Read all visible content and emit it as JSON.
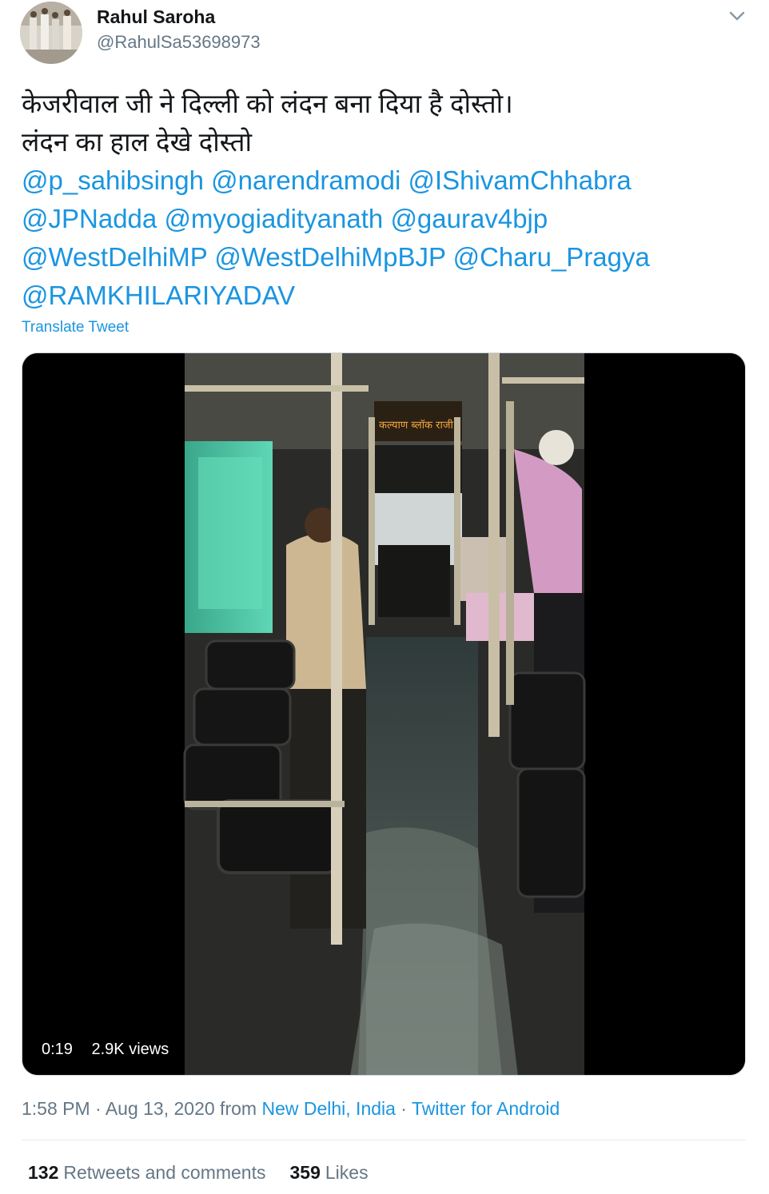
{
  "user": {
    "name": "Rahul Saroha",
    "handle": "@RahulSa53698973"
  },
  "tweet": {
    "lines": [
      [
        "केजरीवाल जी ने दिल्ली को लंदन बना दिया है दोस्तो।"
      ],
      [
        "लंदन का हाल देखे दोस्तो"
      ],
      [
        "@p_sahibsingh",
        "@narendramodi",
        "@IShivamChhabra"
      ],
      [
        "@JPNadda",
        "@myogiadityanath",
        "@gaurav4bjp"
      ],
      [
        "@WestDelhiMP",
        "@WestDelhiMpBJP",
        "@Charu_Pragya"
      ],
      [
        "@RAMKHILARIYADAV"
      ]
    ],
    "translate_label": "Translate Tweet"
  },
  "video": {
    "duration": "0:19",
    "views": "2.9K views",
    "bus_sign_text": "कल्याण ब्लॉक राजी"
  },
  "meta": {
    "time": "1:58 PM",
    "sep1": " · ",
    "date": "Aug 13, 2020",
    "from": " from ",
    "location": "New Delhi, India",
    "sep2": " · ",
    "source": "Twitter for Android"
  },
  "stats": {
    "retweets_count": "132",
    "retweets_label": "Retweets and comments",
    "likes_count": "359",
    "likes_label": "Likes"
  },
  "colors": {
    "link": "#1b95e0",
    "text": "#14171a",
    "muted": "#657786"
  },
  "icons": [
    "avatar",
    "chevron-down-icon"
  ]
}
